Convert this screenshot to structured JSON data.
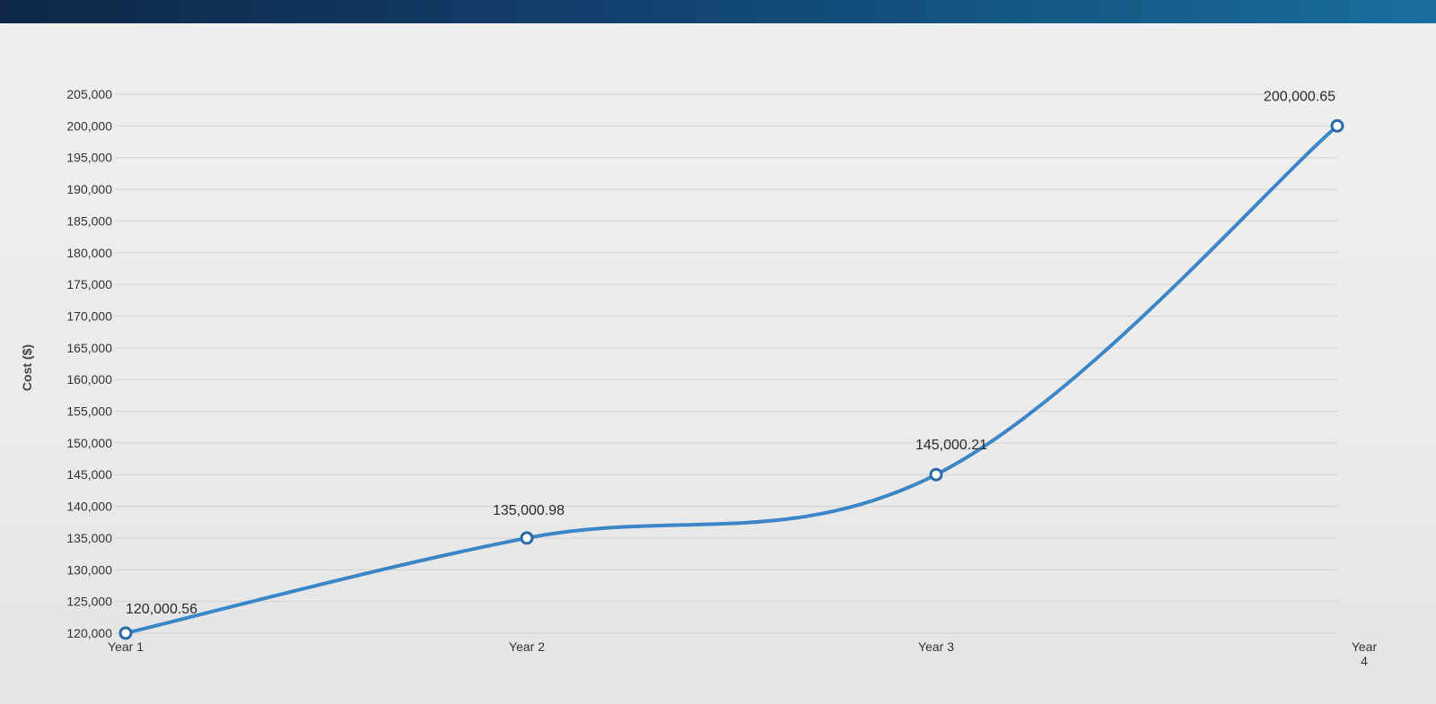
{
  "chart_data": {
    "type": "line",
    "title": "",
    "xlabel": "",
    "ylabel": "Cost ($)",
    "ylim": [
      120000,
      205000
    ],
    "y_ticks": [
      "205,000",
      "200,000",
      "195,000",
      "190,000",
      "185,000",
      "180,000",
      "175,000",
      "170,000",
      "165,000",
      "160,000",
      "155,000",
      "150,000",
      "145,000",
      "140,000",
      "135,000",
      "130,000",
      "125,000",
      "120,000"
    ],
    "categories": [
      "Year 1",
      "Year 2",
      "Year 3",
      "Year 4"
    ],
    "series": [
      {
        "values": [
          120000.56,
          135000.98,
          145000.21,
          200000.65
        ],
        "data_labels": [
          "120,000.56",
          "135,000.98",
          "145,000.21",
          "200,000.65"
        ],
        "color": "#3a86c6"
      }
    ],
    "grid": true,
    "legend": "none"
  }
}
